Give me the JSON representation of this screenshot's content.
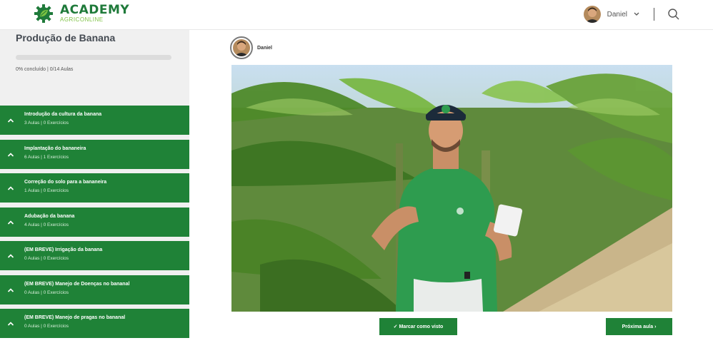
{
  "header": {
    "logo_title": "ACADEMY",
    "logo_subtitle": "AGRICONLINE",
    "user_name": "Daniel",
    "icons": [
      "logo-gear-leaf-icon",
      "chevron-down-icon",
      "search-icon"
    ]
  },
  "sidebar": {
    "course_title": "Produção de Banana",
    "progress_fraction": 0,
    "progress_text": "0% concluído | 0/14 Aulas",
    "modules": [
      {
        "title": "Introdução da cultura da banana",
        "meta": "3 Aulas | 0 Exercícios"
      },
      {
        "title": "Implantação do bananeira",
        "meta": "6 Aulas | 1 Exercícios"
      },
      {
        "title": "Correção do solo para a bananeira",
        "meta": "1 Aulas | 0 Exercícios"
      },
      {
        "title": "Adubação da banana",
        "meta": "4 Aulas | 0 Exercícios"
      },
      {
        "title": "(EM BREVE) Irrigação da banana",
        "meta": "0 Aulas | 0 Exercícios"
      },
      {
        "title": "(EM BREVE) Manejo de Doenças no bananal",
        "meta": "0 Aulas | 0 Exercícios"
      },
      {
        "title": "(EM BREVE) Manejo de pragas no bananal",
        "meta": "0 Aulas | 0 Exercícios"
      }
    ]
  },
  "main": {
    "instructor_name": "Daniel",
    "mark_done_label": "✓ Marcar como visto",
    "next_label": "Próxima aula ›"
  },
  "colors": {
    "brand_green": "#1f8237",
    "logo_green": "#1f7a3a",
    "accent_lime": "#7cc242",
    "sidebar_bg": "#f0f0f0"
  }
}
